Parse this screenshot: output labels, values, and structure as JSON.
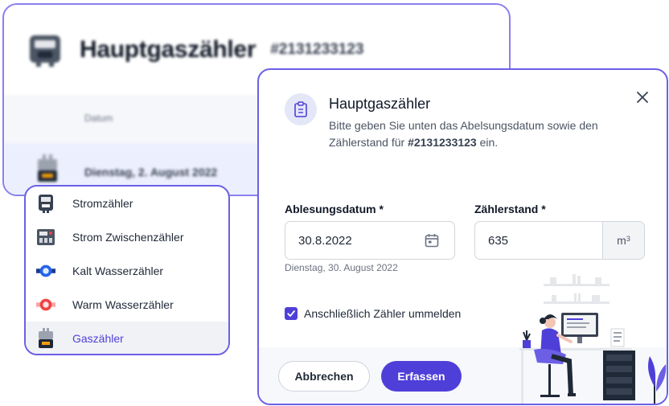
{
  "background_card": {
    "title": "Hauptgaszähler",
    "meter_id": "#2131233123",
    "column_label": "Datum",
    "row_date": "Dienstag, 2. August 2022"
  },
  "menu": {
    "items": [
      {
        "label": "Stromzähler",
        "icon": "electric-meter-icon",
        "selected": false
      },
      {
        "label": "Strom Zwischenzähler",
        "icon": "intermediate-electric-meter-icon",
        "selected": false
      },
      {
        "label": "Kalt Wasserzähler",
        "icon": "cold-water-meter-icon",
        "selected": false
      },
      {
        "label": "Warm Wasserzähler",
        "icon": "warm-water-meter-icon",
        "selected": false
      },
      {
        "label": "Gaszähler",
        "icon": "gas-meter-icon",
        "selected": true
      }
    ]
  },
  "modal": {
    "title": "Hauptgaszähler",
    "description_before": "Bitte geben Sie unten das Abelsungsdatum sowie den Zählerstand für ",
    "meter_id": "#2131233123",
    "description_after": " ein.",
    "date_label": "Ablesungsdatum *",
    "date_value": "30.8.2022",
    "date_hint": "Dienstag, 30. August 2022",
    "reading_label": "Zählerstand *",
    "reading_value": "635",
    "unit_base": "m",
    "unit_exp": "3",
    "checkbox_label": "Anschließlich Zähler ummelden",
    "checkbox_checked": true,
    "cancel_label": "Abbrechen",
    "submit_label": "Erfassen"
  },
  "colors": {
    "accent": "#4f3fd9",
    "border_accent": "#6c5fe6",
    "selected_row": "#eceffd"
  }
}
